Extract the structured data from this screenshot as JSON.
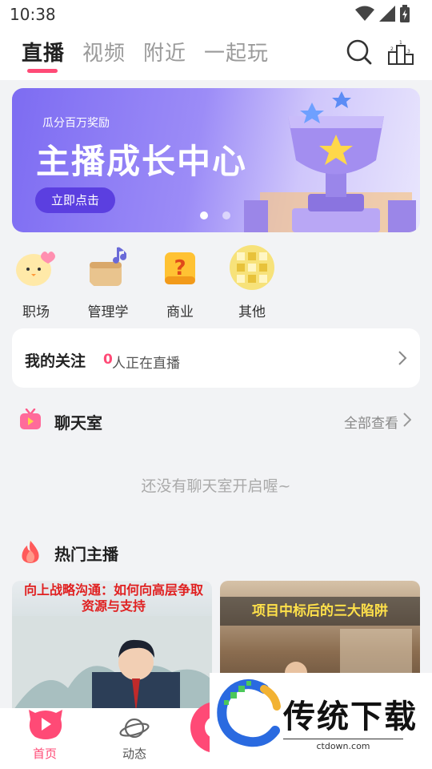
{
  "status_bar": {
    "time": "10:38"
  },
  "top_nav": {
    "tabs": [
      {
        "label": "直播",
        "active": true
      },
      {
        "label": "视频",
        "active": false
      },
      {
        "label": "附近",
        "active": false
      },
      {
        "label": "一起玩",
        "active": false
      }
    ],
    "icons": [
      "search-icon",
      "ranking-icon"
    ]
  },
  "banner": {
    "subtitle": "瓜分百万奖励",
    "title": "主播成长中心",
    "button_label": "立即点击",
    "dots_active_index": 0
  },
  "categories": [
    {
      "label": "职场",
      "icon": "chick-heart-icon"
    },
    {
      "label": "管理学",
      "icon": "music-box-icon"
    },
    {
      "label": "商业",
      "icon": "question-box-icon"
    },
    {
      "label": "其他",
      "icon": "golden-tiles-icon"
    }
  ],
  "follow": {
    "title": "我的关注",
    "count": "0",
    "text": "人正在直播"
  },
  "chat_room": {
    "title": "聊天室",
    "more": "全部查看",
    "empty_text": "还没有聊天室开启喔~"
  },
  "hot_streamers": {
    "title": "热门主播",
    "cards": [
      {
        "title": "向上战略沟通：如何向高层争取资源与支持"
      },
      {
        "title": "项目中标后的三大陷阱"
      }
    ]
  },
  "bottom_nav": {
    "items": [
      {
        "label": "首页",
        "active": true
      },
      {
        "label": "动态",
        "active": false
      }
    ]
  },
  "watermark": {
    "text": "传统下载",
    "url": "ctdown.com"
  },
  "colors": {
    "accent": "#ff4a76",
    "banner_button": "#5b3fe0"
  }
}
